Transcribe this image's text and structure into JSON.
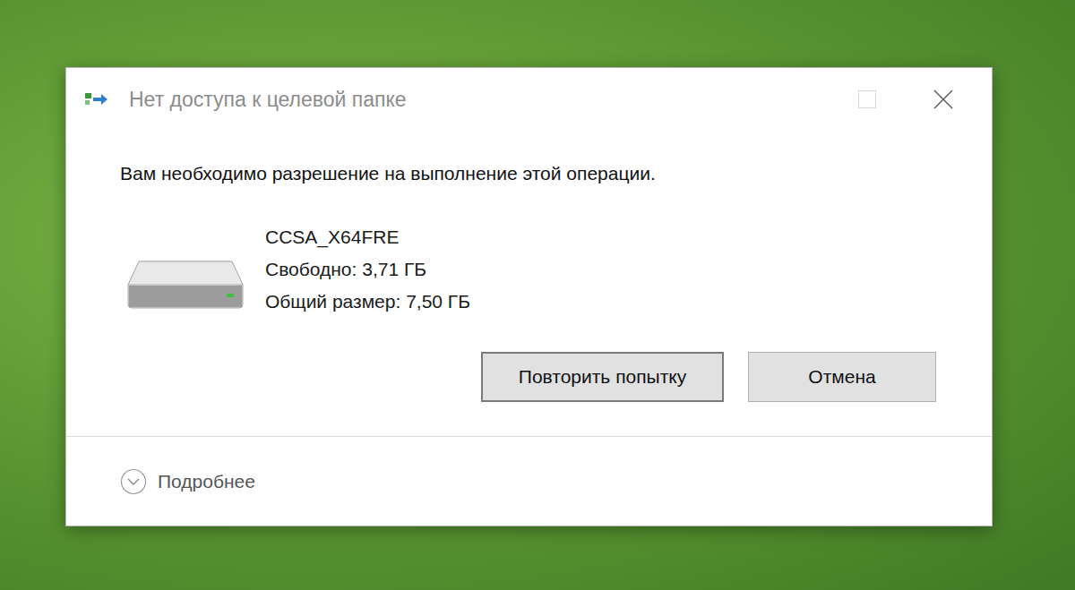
{
  "window": {
    "title": "Нет доступа к целевой папке",
    "controls": [
      {
        "name": "maximize",
        "disabled": true
      },
      {
        "name": "close",
        "disabled": false
      }
    ]
  },
  "message": "Вам необходимо разрешение на выполнение этой операции.",
  "drive": {
    "name": "CCSA_X64FRE",
    "free": "Свободно: 3,71 ГБ",
    "total": "Общий размер: 7,50 ГБ"
  },
  "buttons": [
    {
      "label": "Повторить попытку",
      "default": true
    },
    {
      "label": "Отмена",
      "default": false
    }
  ],
  "details": {
    "label": "Подробнее",
    "expanded": false
  }
}
